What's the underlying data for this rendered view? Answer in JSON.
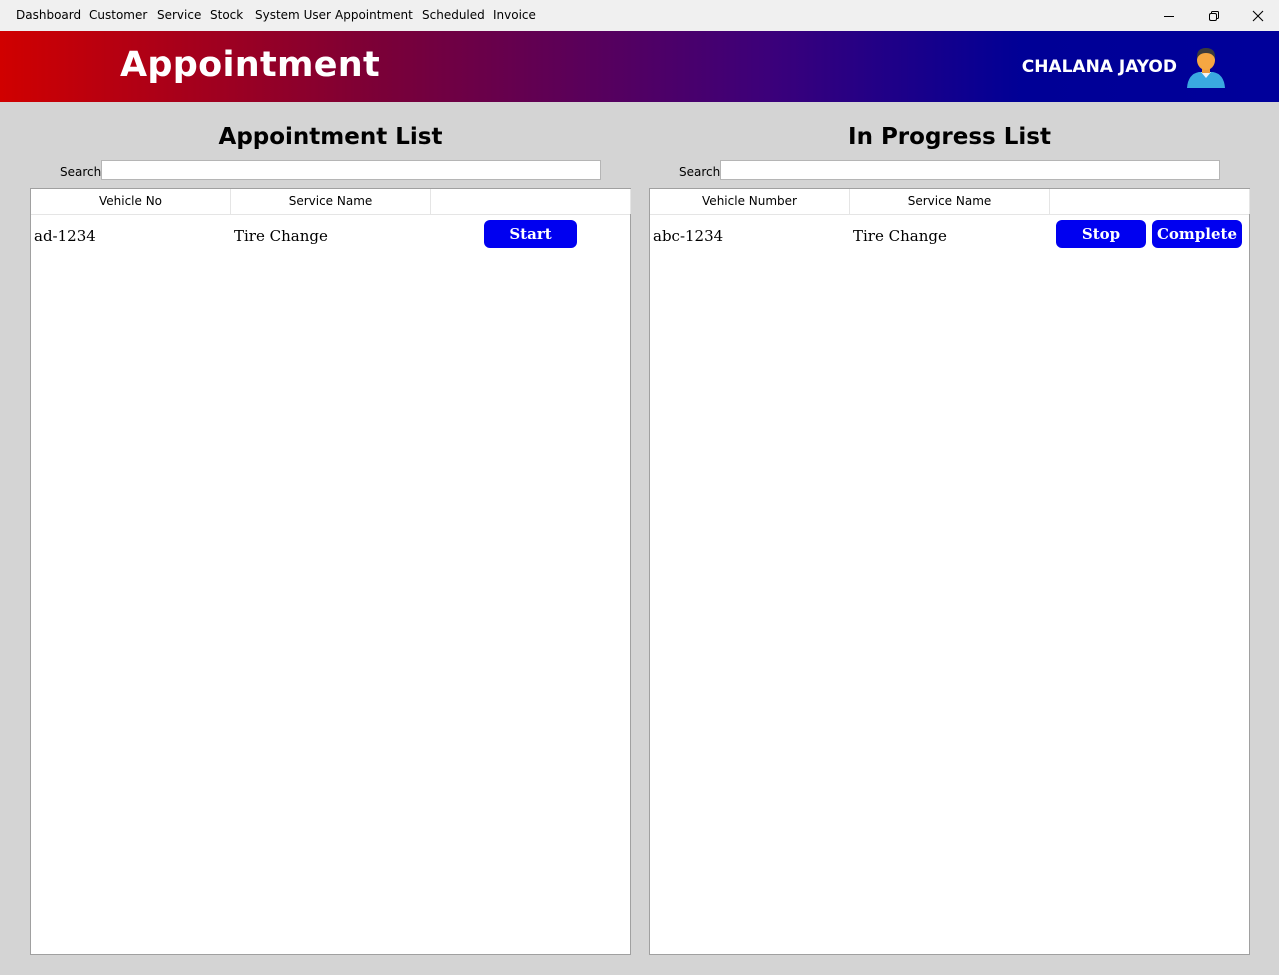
{
  "menu": {
    "items": [
      "Dashboard",
      "Customer",
      "Service",
      "Stock",
      "System User",
      "Appointment",
      "Scheduled",
      "Invoice"
    ]
  },
  "window_controls": {
    "minimize_icon": "minimize-icon",
    "restore_icon": "restore-icon",
    "close_icon": "close-icon"
  },
  "header": {
    "title": "Appointment",
    "user_name": "CHALANA JAYOD",
    "avatar_icon": "user-avatar-icon",
    "gradient_colors": [
      "#d00000",
      "#00009a"
    ]
  },
  "appointment_panel": {
    "title": "Appointment List",
    "search_label": "Search",
    "search_value": "",
    "columns": [
      "Vehicle No",
      "Service Name",
      ""
    ],
    "rows": [
      {
        "vehicle": "ad-1234",
        "service": "Tire Change",
        "action_label": "Start"
      }
    ]
  },
  "progress_panel": {
    "title": "In Progress List",
    "search_label": "Search",
    "search_value": "",
    "columns": [
      "Vehicle Number",
      "Service Name",
      ""
    ],
    "rows": [
      {
        "vehicle": "abc-1234",
        "service": "Tire Change",
        "stop_label": "Stop",
        "complete_label": "Complete"
      }
    ]
  },
  "colors": {
    "button": "#0000f0",
    "background": "#d4d4d4"
  }
}
